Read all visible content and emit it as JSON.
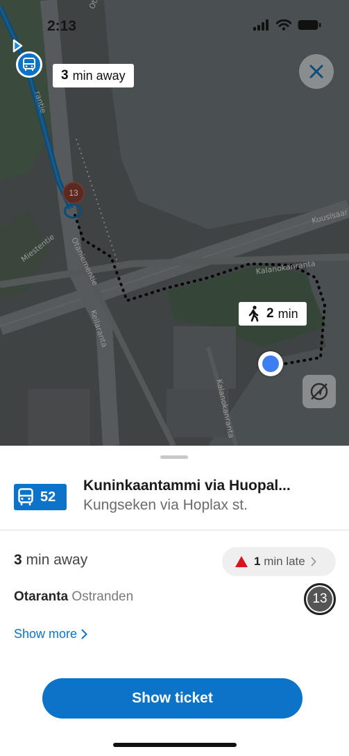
{
  "status_bar": {
    "time": "2:13"
  },
  "map": {
    "bus_eta": {
      "value": "3",
      "unit": "min away"
    },
    "walk_time": {
      "value": "2",
      "unit": "min"
    },
    "stop_marker_code": "13",
    "street_labels": {
      "otaranta": "Otaranta",
      "ranta": "rantie",
      "miestentie": "Miestentie",
      "otaniementie": "Otaniementie",
      "keilaranta": "Keilaranta",
      "kuusisaari": "Kuusisaar",
      "kalanokanranta_top": "Kalanokanranta",
      "kalanokanranta": "Kalanokanranta"
    }
  },
  "route": {
    "number": "52",
    "title": "Kuninkaantammi via Huopal...",
    "subtitle": "Kungseken via Hoplax st."
  },
  "departure": {
    "eta_value": "3",
    "eta_unit": "min away",
    "late_value": "1",
    "late_unit": "min late"
  },
  "stop": {
    "name_fi": "Otaranta",
    "name_sv": "Ostranden",
    "code": "13"
  },
  "actions": {
    "show_more": "Show more",
    "show_ticket": "Show ticket"
  },
  "colors": {
    "accent": "#0b74c9",
    "warning": "#d9141c",
    "map_background": "#3f4344"
  }
}
